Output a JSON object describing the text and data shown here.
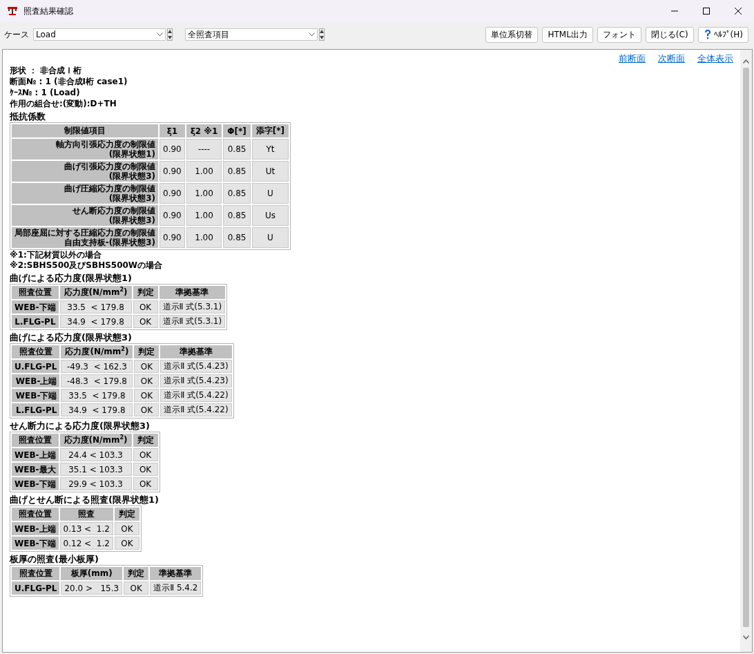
{
  "window": {
    "title": "照査結果確認"
  },
  "toolbar": {
    "case_label": "ケース",
    "case_value": "Load",
    "item_value": "全照査項目",
    "buttons": [
      {
        "label": "単位系切替",
        "kind": "text"
      },
      {
        "label": "HTML出力",
        "kind": "text"
      },
      {
        "label": "フォント",
        "kind": "text"
      },
      {
        "label": "閉じる(C)",
        "kind": "text"
      },
      {
        "label": "ﾍﾙﾌﾟ(H)",
        "kind": "help"
      }
    ]
  },
  "nav_links": [
    "前断面",
    "次断面",
    "全体表示"
  ],
  "info_lines": [
    "形状 ： 非合成Ｉ桁",
    "断面№ : 1 (非合成I桁 case1)",
    "ｹｰｽ№ : 1 (Load)",
    "作用の組合せ:(変動):D+TH"
  ],
  "sections": [
    {
      "title": "抵抗係数",
      "table": {
        "columns": [
          "制限値項目",
          "ξ1",
          "ξ2 ※1",
          "Φ[*]",
          "添字[*]"
        ],
        "rows": [
          [
            [
              "軸方向引張応力度の制限値",
              "(限界状態1)"
            ],
            "0.90",
            "----",
            "0.85",
            "Yt"
          ],
          [
            [
              "曲げ引張応力度の制限値",
              "(限界状態3)"
            ],
            "0.90",
            "1.00",
            "0.85",
            "Ut"
          ],
          [
            [
              "曲げ圧縮応力度の制限値",
              "(限界状態3)"
            ],
            "0.90",
            "1.00",
            "0.85",
            "U"
          ],
          [
            [
              "せん断応力度の制限値",
              "(限界状態3)"
            ],
            "0.90",
            "1.00",
            "0.85",
            "Us"
          ],
          [
            [
              "局部座屈に対する圧縮応力度の制限値",
              "自由支持板-(限界状態3)"
            ],
            "0.90",
            "1.00",
            "0.85",
            "U"
          ]
        ]
      },
      "notes": [
        "※1:下記材質以外の場合",
        "※2:SBHS500及びSBHS500Wの場合"
      ]
    },
    {
      "title": "曲げによる応力度(限界状態1)",
      "table": {
        "columns": [
          "照査位置",
          "応力度(N/mm$^{2}$)",
          "判定",
          "準拠基準"
        ],
        "rows": [
          [
            "WEB-下端",
            "33.5  < 179.8",
            "OK",
            "道示Ⅱ 式(5.3.1)"
          ],
          [
            "L.FLG-PL",
            "34.9  < 179.8",
            "OK",
            "道示Ⅱ 式(5.3.1)"
          ]
        ]
      }
    },
    {
      "title": "曲げによる応力度(限界状態3)",
      "table": {
        "columns": [
          "照査位置",
          "応力度(N/mm$^{2}$)",
          "判定",
          "準拠基準"
        ],
        "rows": [
          [
            "U.FLG-PL",
            "-49.3  < 162.3",
            "OK",
            "道示Ⅱ 式(5.4.23)"
          ],
          [
            "WEB-上端",
            "-48.3  < 179.8",
            "OK",
            "道示Ⅱ 式(5.4.23)"
          ],
          [
            "WEB-下端",
            "33.5  < 179.8",
            "OK",
            "道示Ⅱ 式(5.4.22)"
          ],
          [
            "L.FLG-PL",
            "34.9  < 179.8",
            "OK",
            "道示Ⅱ 式(5.4.22)"
          ]
        ]
      }
    },
    {
      "title": "せん断力による応力度(限界状態3)",
      "table": {
        "columns": [
          "照査位置",
          "応力度(N/mm$^{2}$)",
          "判定"
        ],
        "rows": [
          [
            "WEB-上端",
            "24.4 < 103.3",
            "OK"
          ],
          [
            "WEB-最大",
            "35.1 < 103.3",
            "OK"
          ],
          [
            "WEB-下端",
            "29.9 < 103.3",
            "OK"
          ]
        ]
      }
    },
    {
      "title": "曲げとせん断による照査(限界状態1)",
      "table": {
        "columns": [
          "照査位置",
          "照査",
          "判定"
        ],
        "rows": [
          [
            "WEB-上端",
            "0.13 <  1.2",
            "OK"
          ],
          [
            "WEB-下端",
            "0.12 <  1.2",
            "OK"
          ]
        ]
      }
    },
    {
      "title": "板厚の照査(最小板厚)",
      "table": {
        "columns": [
          "照査位置",
          "板厚(mm)",
          "判定",
          "準拠基準"
        ],
        "rows": [
          [
            "U.FLG-PL",
            "20.0 >   15.3",
            "OK",
            "道示Ⅱ 5.4.2"
          ]
        ]
      }
    }
  ]
}
